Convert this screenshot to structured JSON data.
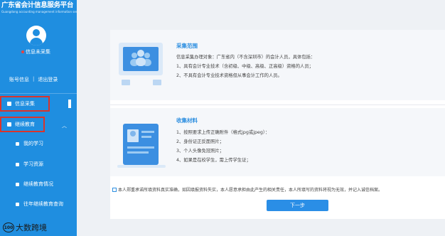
{
  "sidebar": {
    "brand_title": "广东省会计信息服务平台",
    "brand_subtitle": "Guangdong accounting management information service platform",
    "login_status": "信息未采集",
    "account_info": "账号信息",
    "divider": "|",
    "logout": "退出登录",
    "nav": {
      "collect": "信息采集",
      "continuing_edu": "继续教育",
      "my_study": "我的学习",
      "resources": "学习资源",
      "edu_status": "继续教育情况",
      "past_query": "往年继续教育查询"
    },
    "accent": "#1f8ee0"
  },
  "watermark": {
    "logo": "100",
    "text": "大数跨境"
  },
  "section1": {
    "title": "采集范围",
    "lines": [
      "信息采集办理对象：广东省内（不含深圳市）的会计人员，具体包括：",
      "1、具有会计专业技术（含初级、中级、高级、正高级）资格的人员；",
      "2、不具有会计专业技术资格但从事会计工作的人员。"
    ]
  },
  "section2": {
    "title": "收集材料",
    "lines": [
      "1、按照要求上传正确附件（格式jpg或jpeg）：",
      "2、身份证正反面照片；",
      "3、个人头像免冠照片；",
      "4、如果是在校学生，需上传学生证；"
    ]
  },
  "agreement": "本人郑重承诺所填资料真实准确，如因填报资料失实，本人愿意承担由此产生的相关责任，本人所填写的资料将视为无效，并记入诚信档案。",
  "next_button": "下一步",
  "colors": {
    "highlight_box": "#d9342b",
    "title_blue": "#2e8fe0",
    "button": "#2a8ee6"
  }
}
